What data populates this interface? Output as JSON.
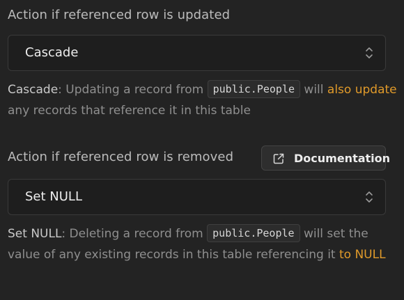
{
  "update_section": {
    "label": "Action if referenced row is updated",
    "selected": "Cascade",
    "help": {
      "title": "Cascade",
      "text1": ": Updating a record from ",
      "table": "public.People",
      "text2": " will ",
      "accent": "also update",
      "text3": " any records that reference it in this table"
    }
  },
  "delete_section": {
    "label": "Action if referenced row is removed",
    "selected": "Set NULL",
    "help": {
      "title": "Set NULL",
      "text1": ": Deleting a record from ",
      "table": "public.People",
      "text2": " will set the value of any existing records in this table referencing it ",
      "accent": "to NULL"
    }
  },
  "documentation_button": {
    "label": "Documentation",
    "icon": "external-link-icon"
  },
  "colors": {
    "background": "#232323",
    "accent": "#e09a2a",
    "muted_text": "#8f8f8f"
  }
}
